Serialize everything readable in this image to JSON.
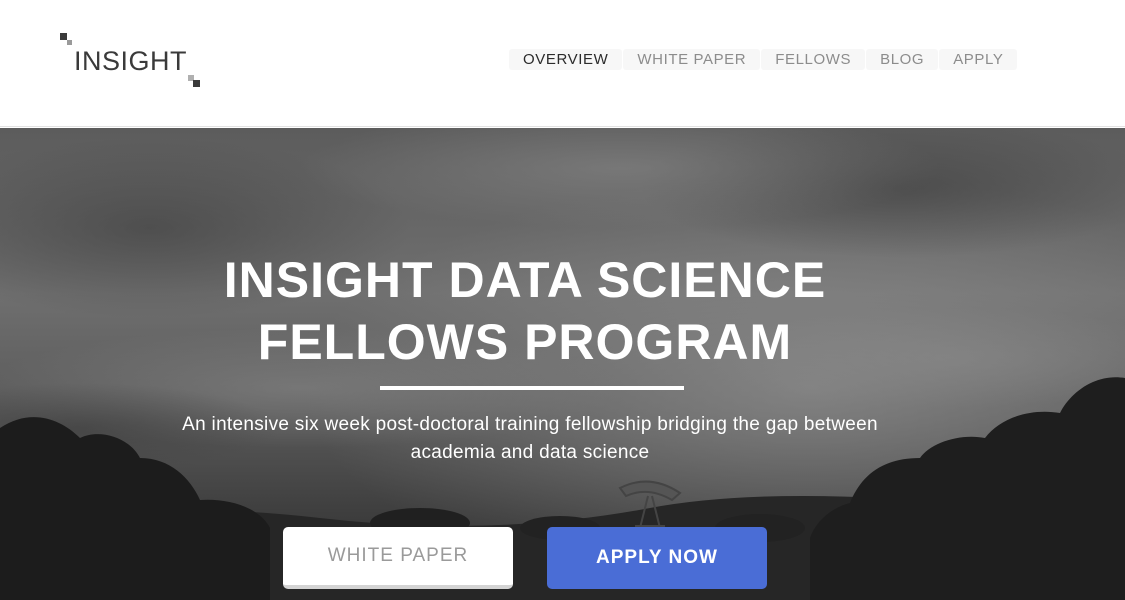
{
  "brand": {
    "logo_text": "INSIGHT"
  },
  "nav": {
    "items": [
      {
        "label": "OVERVIEW",
        "active": true
      },
      {
        "label": "WHITE PAPER",
        "active": false
      },
      {
        "label": "FELLOWS",
        "active": false
      },
      {
        "label": "BLOG",
        "active": false
      },
      {
        "label": "APPLY",
        "active": false
      }
    ]
  },
  "hero": {
    "title_line1": "INSIGHT DATA SCIENCE",
    "title_line2": "FELLOWS PROGRAM",
    "subtitle_line1": "An intensive six week post-doctoral training fellowship bridging the gap between",
    "subtitle_line2": "academia and data science",
    "buttons": {
      "white_paper": "WHITE PAPER",
      "apply_now": "APPLY NOW"
    }
  },
  "colors": {
    "accent": "#4a6dd6",
    "nav_active": "#2b2b2b",
    "nav_inactive": "#8c8c8c"
  }
}
